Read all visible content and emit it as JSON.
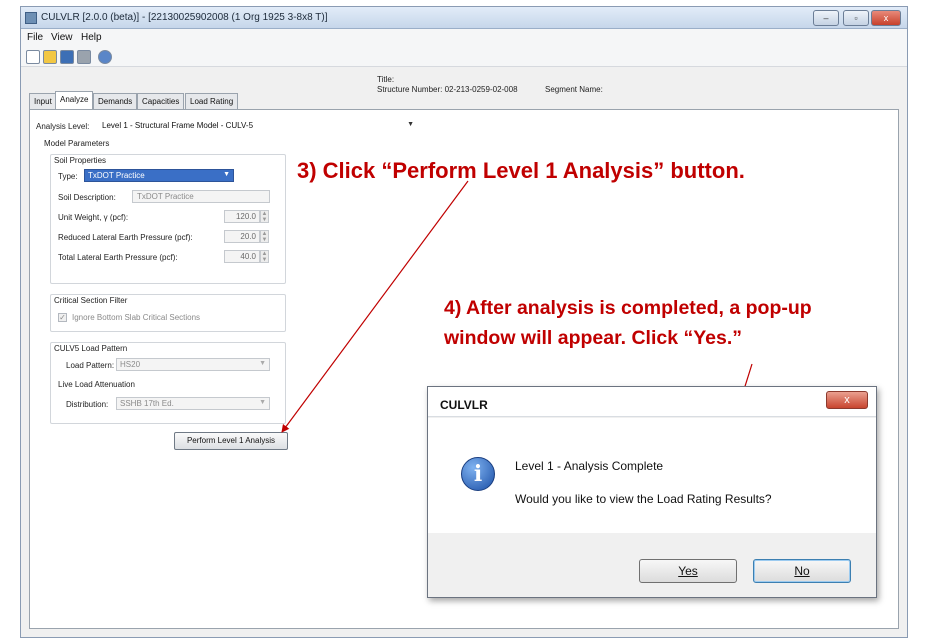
{
  "window": {
    "title": "CULVLR [2.0.0 (beta)] - [22130025902008 (1 Org 1925 3-8x8 T)]",
    "minimize": "–",
    "maximize": "▫",
    "close": "x"
  },
  "menu": [
    "File",
    "View",
    "Help"
  ],
  "toolbar": {
    "icons": [
      "new-icon",
      "open-icon",
      "save-icon",
      "print-icon",
      "settings-icon"
    ]
  },
  "header": {
    "title_label": "Title:",
    "structure_number": "Structure Number: 02-213-0259-02-008",
    "segment_name": "Segment Name:"
  },
  "tabs": [
    {
      "label": "Input",
      "active": false
    },
    {
      "label": "Analyze",
      "active": true
    },
    {
      "label": "Demands",
      "active": false
    },
    {
      "label": "Capacities",
      "active": false
    },
    {
      "label": "Load Rating",
      "active": false
    }
  ],
  "analyze": {
    "analysis_level_label": "Analysis Level:",
    "analysis_level_value": "Level 1 - Structural Frame Model - CULV-5",
    "model_parameters": "Model Parameters",
    "soil": {
      "group": "Soil Properties",
      "type_label": "Type:",
      "type_value": "TxDOT Practice",
      "desc_label": "Soil Description:",
      "desc_value": "TxDOT Practice",
      "unit_weight_label": "Unit Weight, γ (pcf):",
      "unit_weight_value": "120.0",
      "reduced_label": "Reduced Lateral Earth Pressure (pcf):",
      "reduced_value": "20.0",
      "total_label": "Total Lateral Earth Pressure (pcf):",
      "total_value": "40.0"
    },
    "critical": {
      "group": "Critical Section Filter",
      "checkbox_label": "Ignore Bottom Slab Critical Sections"
    },
    "culv5": {
      "group": "CULV5 Load Pattern",
      "load_pattern_label": "Load Pattern:",
      "load_pattern_value": "HS20",
      "live_load_label": "Live Load Attenuation",
      "distribution_label": "Distribution:",
      "distribution_value": "SSHB 17th Ed."
    },
    "perform_button": "Perform Level 1 Analysis"
  },
  "annotations": {
    "step3": "3) Click “Perform Level 1 Analysis” button.",
    "step4_line1": "4) After analysis is completed, a pop-up",
    "step4_line2": "window will appear. Click “Yes.”",
    "color": "#c00000"
  },
  "dialog": {
    "title": "CULVLR",
    "close": "x",
    "icon": "info-icon",
    "message1": "Level 1 - Analysis Complete",
    "message2": "Would you like to view the Load Rating Results?",
    "yes_label": "Yes",
    "no_label": "No"
  }
}
